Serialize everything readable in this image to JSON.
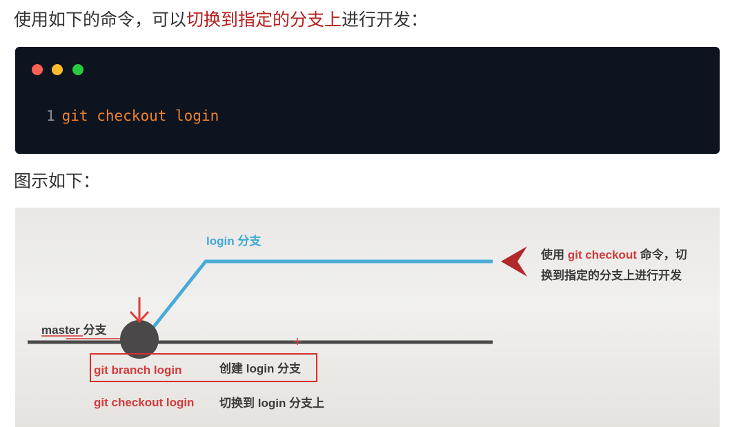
{
  "intro": {
    "before": "使用如下的命令，可以",
    "highlight": "切换到指定的分支上",
    "after": "进行开发："
  },
  "code": {
    "line_number": "1",
    "command": "git checkout login"
  },
  "caption": "图示如下：",
  "figure": {
    "login_branch_label": "login 分支",
    "callout_line1_before": "使用 ",
    "callout_line1_cmd": "git checkout",
    "callout_line1_after": " 命令，切",
    "callout_line2": "换到指定的分支上进行开发",
    "master_label": "master 分支",
    "branch_cmd": "git branch login",
    "branch_desc": "创建 login 分支",
    "checkout_cmd": "git checkout login",
    "checkout_desc": "切换到 login 分支上"
  },
  "colors": {
    "highlight_text": "#b71c1c",
    "code_background": "#0e1320",
    "code_text": "#f0822c",
    "branch_blue": "#3fa7d6",
    "command_red": "#d13a3a"
  },
  "icons": [
    "window-close-dot",
    "window-minimize-dot",
    "window-maximize-dot",
    "down-arrow-icon",
    "left-arrow-icon"
  ]
}
